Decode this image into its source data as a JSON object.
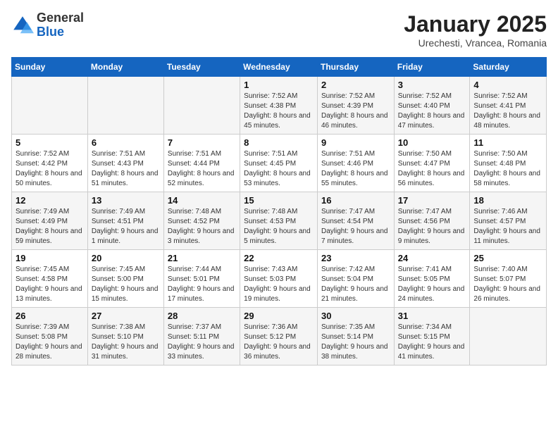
{
  "header": {
    "logo_general": "General",
    "logo_blue": "Blue",
    "title": "January 2025",
    "subtitle": "Urechesti, Vrancea, Romania"
  },
  "calendar": {
    "days_of_week": [
      "Sunday",
      "Monday",
      "Tuesday",
      "Wednesday",
      "Thursday",
      "Friday",
      "Saturday"
    ],
    "weeks": [
      [
        {
          "day": "",
          "info": ""
        },
        {
          "day": "",
          "info": ""
        },
        {
          "day": "",
          "info": ""
        },
        {
          "day": "1",
          "info": "Sunrise: 7:52 AM\nSunset: 4:38 PM\nDaylight: 8 hours and 45 minutes."
        },
        {
          "day": "2",
          "info": "Sunrise: 7:52 AM\nSunset: 4:39 PM\nDaylight: 8 hours and 46 minutes."
        },
        {
          "day": "3",
          "info": "Sunrise: 7:52 AM\nSunset: 4:40 PM\nDaylight: 8 hours and 47 minutes."
        },
        {
          "day": "4",
          "info": "Sunrise: 7:52 AM\nSunset: 4:41 PM\nDaylight: 8 hours and 48 minutes."
        }
      ],
      [
        {
          "day": "5",
          "info": "Sunrise: 7:52 AM\nSunset: 4:42 PM\nDaylight: 8 hours and 50 minutes."
        },
        {
          "day": "6",
          "info": "Sunrise: 7:51 AM\nSunset: 4:43 PM\nDaylight: 8 hours and 51 minutes."
        },
        {
          "day": "7",
          "info": "Sunrise: 7:51 AM\nSunset: 4:44 PM\nDaylight: 8 hours and 52 minutes."
        },
        {
          "day": "8",
          "info": "Sunrise: 7:51 AM\nSunset: 4:45 PM\nDaylight: 8 hours and 53 minutes."
        },
        {
          "day": "9",
          "info": "Sunrise: 7:51 AM\nSunset: 4:46 PM\nDaylight: 8 hours and 55 minutes."
        },
        {
          "day": "10",
          "info": "Sunrise: 7:50 AM\nSunset: 4:47 PM\nDaylight: 8 hours and 56 minutes."
        },
        {
          "day": "11",
          "info": "Sunrise: 7:50 AM\nSunset: 4:48 PM\nDaylight: 8 hours and 58 minutes."
        }
      ],
      [
        {
          "day": "12",
          "info": "Sunrise: 7:49 AM\nSunset: 4:49 PM\nDaylight: 8 hours and 59 minutes."
        },
        {
          "day": "13",
          "info": "Sunrise: 7:49 AM\nSunset: 4:51 PM\nDaylight: 9 hours and 1 minute."
        },
        {
          "day": "14",
          "info": "Sunrise: 7:48 AM\nSunset: 4:52 PM\nDaylight: 9 hours and 3 minutes."
        },
        {
          "day": "15",
          "info": "Sunrise: 7:48 AM\nSunset: 4:53 PM\nDaylight: 9 hours and 5 minutes."
        },
        {
          "day": "16",
          "info": "Sunrise: 7:47 AM\nSunset: 4:54 PM\nDaylight: 9 hours and 7 minutes."
        },
        {
          "day": "17",
          "info": "Sunrise: 7:47 AM\nSunset: 4:56 PM\nDaylight: 9 hours and 9 minutes."
        },
        {
          "day": "18",
          "info": "Sunrise: 7:46 AM\nSunset: 4:57 PM\nDaylight: 9 hours and 11 minutes."
        }
      ],
      [
        {
          "day": "19",
          "info": "Sunrise: 7:45 AM\nSunset: 4:58 PM\nDaylight: 9 hours and 13 minutes."
        },
        {
          "day": "20",
          "info": "Sunrise: 7:45 AM\nSunset: 5:00 PM\nDaylight: 9 hours and 15 minutes."
        },
        {
          "day": "21",
          "info": "Sunrise: 7:44 AM\nSunset: 5:01 PM\nDaylight: 9 hours and 17 minutes."
        },
        {
          "day": "22",
          "info": "Sunrise: 7:43 AM\nSunset: 5:03 PM\nDaylight: 9 hours and 19 minutes."
        },
        {
          "day": "23",
          "info": "Sunrise: 7:42 AM\nSunset: 5:04 PM\nDaylight: 9 hours and 21 minutes."
        },
        {
          "day": "24",
          "info": "Sunrise: 7:41 AM\nSunset: 5:05 PM\nDaylight: 9 hours and 24 minutes."
        },
        {
          "day": "25",
          "info": "Sunrise: 7:40 AM\nSunset: 5:07 PM\nDaylight: 9 hours and 26 minutes."
        }
      ],
      [
        {
          "day": "26",
          "info": "Sunrise: 7:39 AM\nSunset: 5:08 PM\nDaylight: 9 hours and 28 minutes."
        },
        {
          "day": "27",
          "info": "Sunrise: 7:38 AM\nSunset: 5:10 PM\nDaylight: 9 hours and 31 minutes."
        },
        {
          "day": "28",
          "info": "Sunrise: 7:37 AM\nSunset: 5:11 PM\nDaylight: 9 hours and 33 minutes."
        },
        {
          "day": "29",
          "info": "Sunrise: 7:36 AM\nSunset: 5:12 PM\nDaylight: 9 hours and 36 minutes."
        },
        {
          "day": "30",
          "info": "Sunrise: 7:35 AM\nSunset: 5:14 PM\nDaylight: 9 hours and 38 minutes."
        },
        {
          "day": "31",
          "info": "Sunrise: 7:34 AM\nSunset: 5:15 PM\nDaylight: 9 hours and 41 minutes."
        },
        {
          "day": "",
          "info": ""
        }
      ]
    ]
  }
}
